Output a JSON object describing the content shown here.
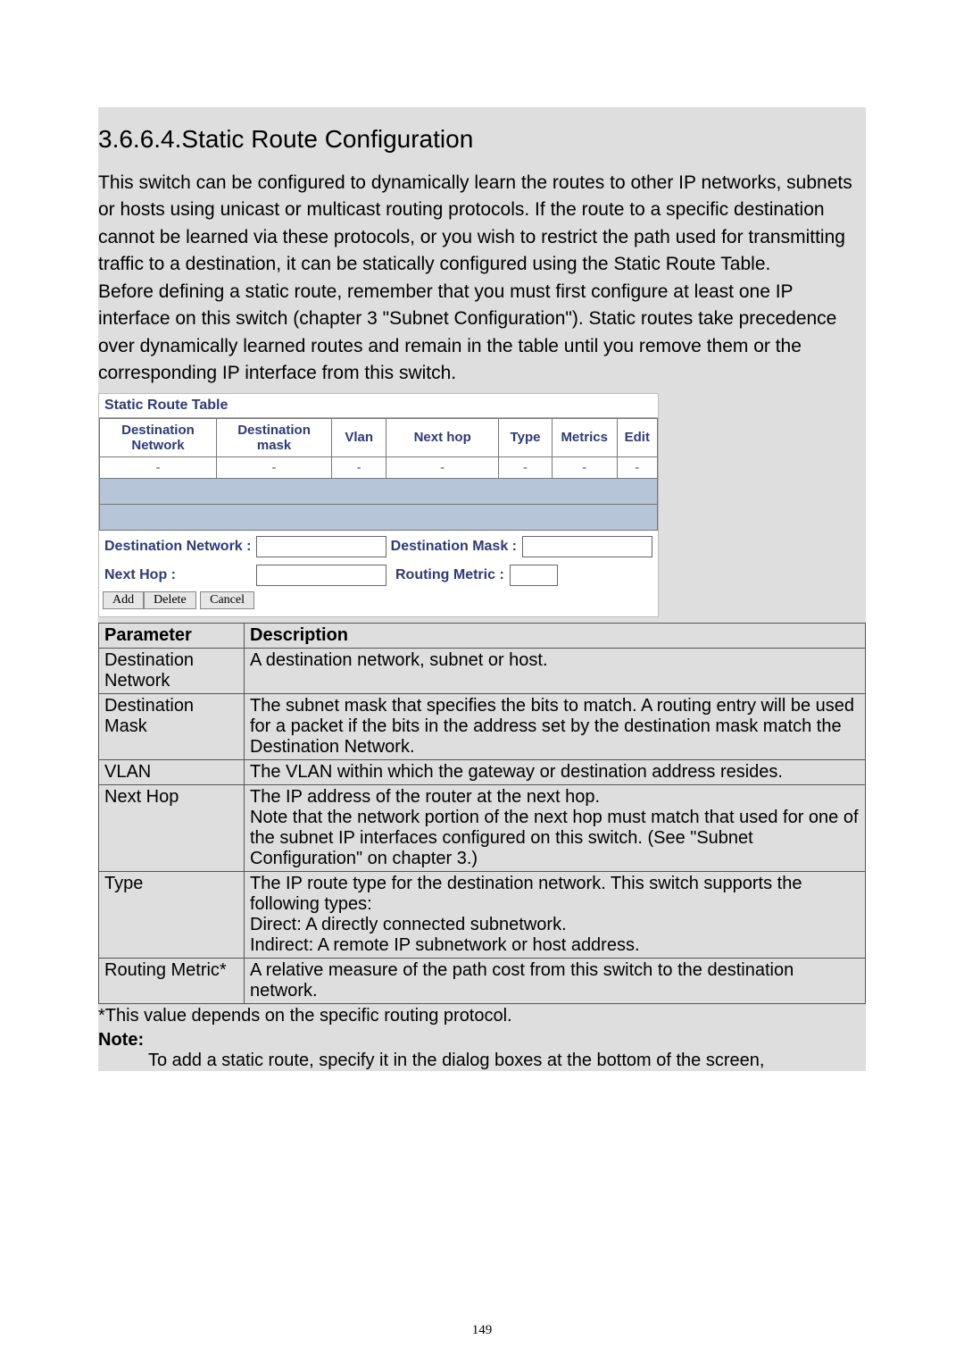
{
  "heading": "3.6.6.4.Static Route Configuration",
  "intro1": "This switch can be configured to dynamically learn the routes to other IP networks, subnets or hosts using unicast or multicast routing protocols. If the route to a specific destination cannot be learned via these protocols, or you wish to restrict the path used for transmitting traffic to a destination, it can be statically configured using the Static Route Table.",
  "intro2": "Before defining a static route, remember that you must first configure at least one IP interface on this switch (chapter 3 \"Subnet Configuration\"). Static routes take precedence over dynamically learned routes and remain in the table until you remove them or the corresponding IP interface from this switch.",
  "srt": {
    "title": "Static Route Table",
    "cols": {
      "c1": "Destination Network",
      "c2": "Destination mask",
      "c3": "Vlan",
      "c4": "Next hop",
      "c5": "Type",
      "c6": "Metrics",
      "c7": "Edit"
    },
    "form": {
      "dest_net": "Destination Network :",
      "dest_mask": "Destination Mask :",
      "next_hop": "Next Hop :",
      "routing_metric": "Routing Metric :"
    },
    "buttons": {
      "add": "Add",
      "delete": "Delete",
      "cancel": "Cancel"
    }
  },
  "param_table": {
    "h1": "Parameter",
    "h2": "Description",
    "rows": [
      {
        "p": "Destination Network",
        "d": "A destination network, subnet or host."
      },
      {
        "p": "Destination Mask",
        "d": "The subnet mask that specifies the bits to match. A routing entry will be used for a packet if the bits in the address set by the destination mask match the Destination Network."
      },
      {
        "p": "VLAN",
        "d": "The VLAN within which the gateway or destination address resides."
      },
      {
        "p": "Next Hop",
        "d": "The IP address of the router at the next hop.\nNote that the network portion of the next hop must match that used for one of the subnet IP interfaces configured on this switch. (See \"Subnet Configuration\" on chapter 3.)"
      },
      {
        "p": "Type",
        "d": "The IP route type for the destination network. This switch supports the following types:\nDirect:     A directly connected subnetwork.\nIndirect:  A remote IP subnetwork or host address."
      },
      {
        "p": "Routing Metric*",
        "d": "A relative measure of the path cost from this switch to the destination network."
      }
    ]
  },
  "footnote": "*This value depends on the specific routing protocol.",
  "note_label": "Note:",
  "note_body": "To add a static route, specify it in the dialog boxes at the bottom of the screen,",
  "page_number": "149"
}
